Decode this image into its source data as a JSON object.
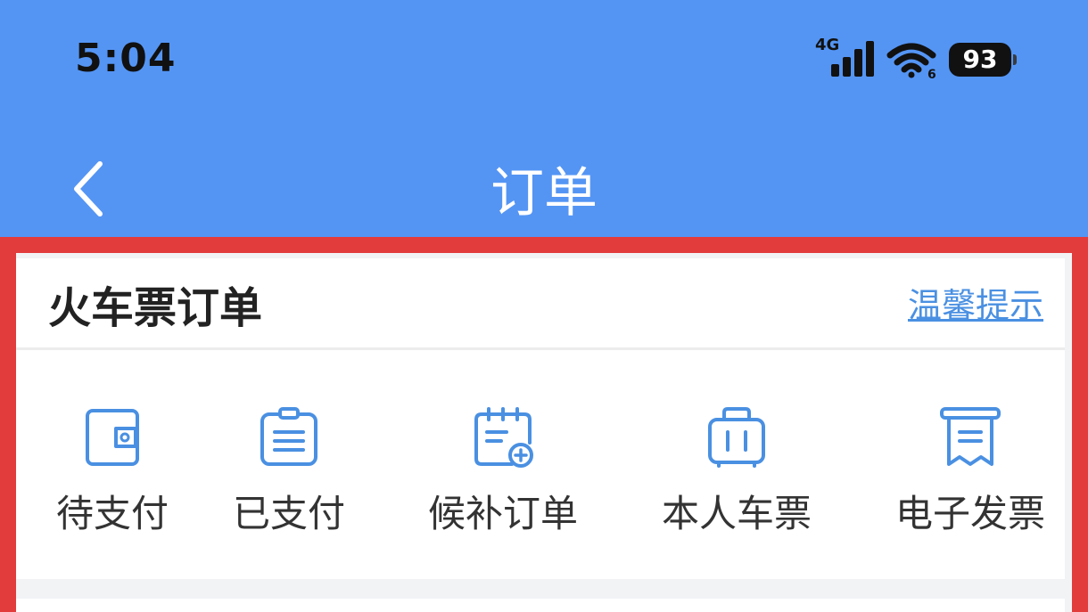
{
  "status_bar": {
    "time": "5:04",
    "network": "4G",
    "battery": "93"
  },
  "nav": {
    "title": "订单"
  },
  "orders": {
    "section_title": "火车票订单",
    "tips_link": "温馨提示",
    "entries": [
      {
        "label": "待支付",
        "icon": "wallet-icon"
      },
      {
        "label": "已支付",
        "icon": "clipboard-icon"
      },
      {
        "label": "候补订单",
        "icon": "calendar-add-icon"
      },
      {
        "label": "本人车票",
        "icon": "suitcase-icon"
      },
      {
        "label": "电子发票",
        "icon": "receipt-icon"
      }
    ]
  },
  "colors": {
    "header_blue": "#5495f4",
    "icon_blue": "#4a90e2",
    "highlight_red": "#e23c3c"
  }
}
